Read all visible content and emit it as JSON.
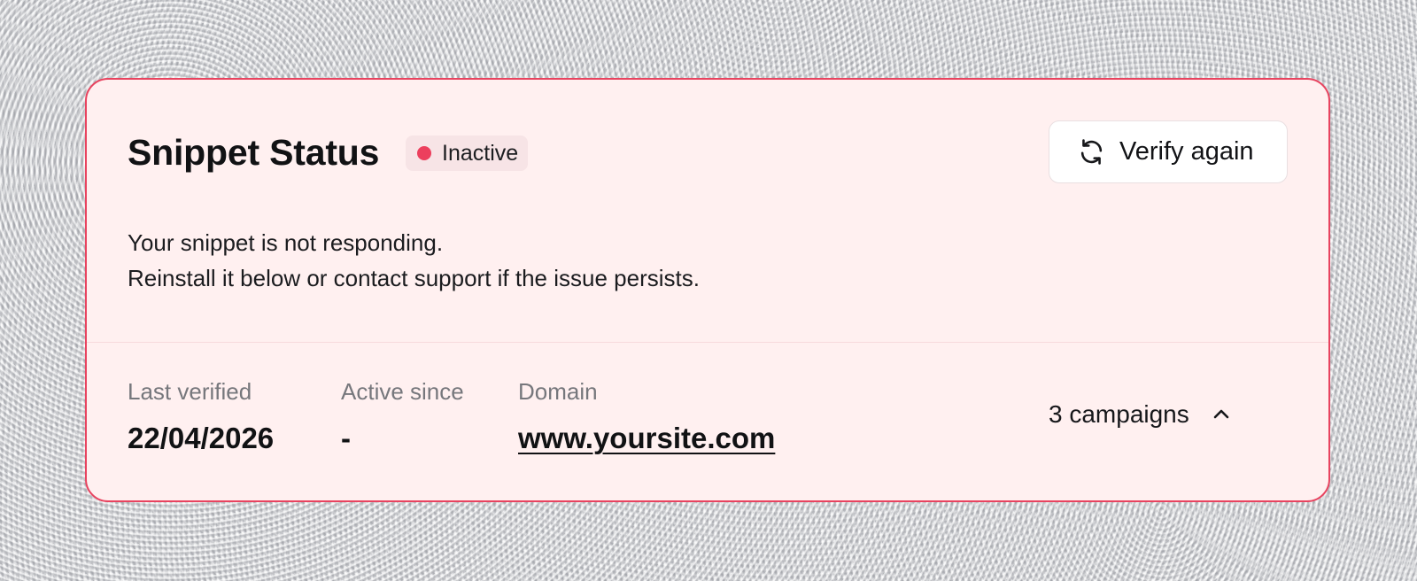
{
  "snippet": {
    "title": "Snippet Status",
    "status": {
      "label": "Inactive",
      "color": "#ec3f5d"
    },
    "verify_button": {
      "label": "Verify again",
      "icon": "refresh-icon"
    },
    "message": {
      "line1": "Your snippet is not responding.",
      "line2": "Reinstall it below or contact support if the issue persists."
    },
    "details": {
      "last_verified": {
        "label": "Last verified",
        "value": "22/04/2026"
      },
      "active_since": {
        "label": "Active since",
        "value": "-"
      },
      "domain": {
        "label": "Domain",
        "value": "www.yoursite.com"
      }
    },
    "campaigns_toggle": {
      "label": "3 campaigns",
      "icon": "chevron-up-icon"
    }
  },
  "theme": {
    "accent": "#e8435f",
    "card_background": "#fff0f0"
  }
}
